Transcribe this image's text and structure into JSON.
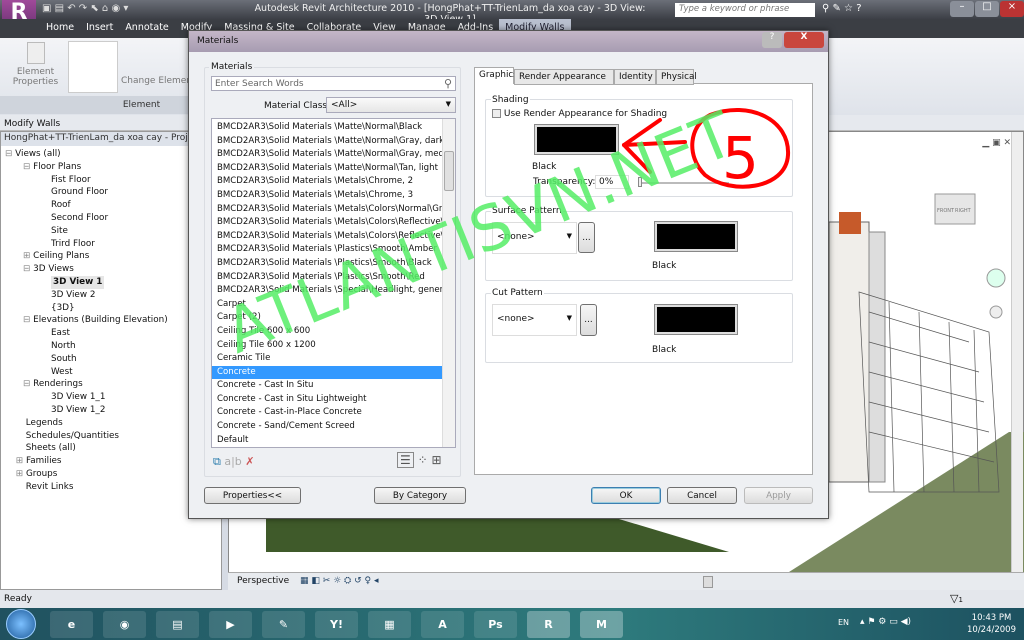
{
  "app": {
    "title": "Autodesk Revit Architecture 2010 - [HongPhat+TT-TrienLam_da xoa cay - 3D View: 3D View 1]",
    "search_placeholder": "Type a keyword or phrase"
  },
  "ribbon": {
    "tabs": [
      "Home",
      "Insert",
      "Annotate",
      "Modify",
      "Massing & Site",
      "Collaborate",
      "View",
      "Manage",
      "Add-Ins",
      "Modify Walls"
    ],
    "active_tab": "Modify Walls",
    "element_properties": "Element Properties",
    "change_element": "Change Element",
    "panel_label": "Element"
  },
  "context_bar": "Modify Walls",
  "browser": {
    "header": "HongPhat+TT-TrienLam_da xoa cay - Project Browser",
    "items": [
      {
        "label": "Views (all)",
        "level": 0,
        "toggle": "-"
      },
      {
        "label": "Floor Plans",
        "level": 1,
        "toggle": "-"
      },
      {
        "label": "Fist Floor",
        "level": 2
      },
      {
        "label": "Ground Floor",
        "level": 2
      },
      {
        "label": "Roof",
        "level": 2
      },
      {
        "label": "Second Floor",
        "level": 2
      },
      {
        "label": "Site",
        "level": 2
      },
      {
        "label": "Trird Floor",
        "level": 2
      },
      {
        "label": "Ceiling Plans",
        "level": 1,
        "toggle": "+"
      },
      {
        "label": "3D Views",
        "level": 1,
        "toggle": "-"
      },
      {
        "label": "3D View 1",
        "level": 2,
        "bold": true
      },
      {
        "label": "3D View 2",
        "level": 2
      },
      {
        "label": "{3D}",
        "level": 2
      },
      {
        "label": "Elevations (Building Elevation)",
        "level": 1,
        "toggle": "-"
      },
      {
        "label": "East",
        "level": 2
      },
      {
        "label": "North",
        "level": 2
      },
      {
        "label": "South",
        "level": 2
      },
      {
        "label": "West",
        "level": 2
      },
      {
        "label": "Renderings",
        "level": 1,
        "toggle": "-"
      },
      {
        "label": "3D View 1_1",
        "level": 2
      },
      {
        "label": "3D View 1_2",
        "level": 2
      },
      {
        "label": "Legends",
        "level": 0.6
      },
      {
        "label": "Schedules/Quantities",
        "level": 0.6
      },
      {
        "label": "Sheets (all)",
        "level": 0.6
      },
      {
        "label": "Families",
        "level": 0.6,
        "toggle": "+"
      },
      {
        "label": "Groups",
        "level": 0.6,
        "toggle": "+"
      },
      {
        "label": "Revit Links",
        "level": 0.6
      }
    ]
  },
  "viewbar": {
    "mode": "Perspective"
  },
  "viewcube": {
    "front": "FRONT",
    "right": "RIGHT"
  },
  "status": "Ready",
  "filter_count": "1",
  "dialog": {
    "title": "Materials",
    "help": "?",
    "close": "X",
    "materials_group": "Materials",
    "search_placeholder": "Enter Search Words",
    "class_label": "Material Class:",
    "class_value": "<All>",
    "list": [
      "BMCD2AR3\\Solid Materials \\Matte\\Normal\\Black",
      "BMCD2AR3\\Solid Materials \\Matte\\Normal\\Gray, dark",
      "BMCD2AR3\\Solid Materials \\Matte\\Normal\\Gray, medium",
      "BMCD2AR3\\Solid Materials \\Matte\\Normal\\Tan, light",
      "BMCD2AR3\\Solid Materials \\Metals\\Chrome, 2",
      "BMCD2AR3\\Solid Materials \\Metals\\Chrome, 3",
      "BMCD2AR3\\Solid Materials \\Metals\\Colors\\Normal\\Gray...",
      "BMCD2AR3\\Solid Materials \\Metals\\Colors\\Reflective\\G...",
      "BMCD2AR3\\Solid Materials \\Metals\\Colors\\Reflective\\G...",
      "BMCD2AR3\\Solid Materials \\Plastics\\Smooth\\Amber",
      "BMCD2AR3\\Solid Materials \\Plastics\\Smooth\\Black",
      "BMCD2AR3\\Solid Materials \\Plastics\\Smooth\\Red",
      "BMCD2AR3\\Solid Materials \\Special\\Headlight, generic, ...",
      "Carpet",
      "Carpet (2)",
      "Ceiling Tile 600 x 600",
      "Ceiling Tile 600 x 1200",
      "Ceramic Tile",
      "Concrete",
      "Concrete - Cast In Situ",
      "Concrete - Cast in Situ Lightweight",
      "Concrete - Cast-in-Place Concrete",
      "Concrete - Sand/Cement Screed",
      "Default"
    ],
    "selected": "Concrete",
    "tabs": [
      "Graphics",
      "Render Appearance",
      "Identity",
      "Physical"
    ],
    "active_tab": "Graphics",
    "shading": {
      "label": "Shading",
      "use_render": "Use Render Appearance for Shading",
      "use_render_checked": false,
      "color_name": "Black",
      "color": "#000000",
      "transparency_label": "Transparency:",
      "transparency": "0%"
    },
    "surface": {
      "label": "Surface Pattern",
      "pattern": "<none>",
      "browse": "...",
      "color_name": "Black"
    },
    "cut": {
      "label": "Cut Pattern",
      "pattern": "<none>",
      "browse": "...",
      "color_name": "Black"
    },
    "buttons": {
      "properties": "Properties<<",
      "by_category": "By Category",
      "ok": "OK",
      "cancel": "Cancel",
      "apply": "Apply"
    }
  },
  "annotation": {
    "number": "5",
    "color": "#ff0000"
  },
  "watermark": "ATLANTISVN.NET",
  "taskbar": {
    "apps": [
      "start",
      "internet-explorer",
      "firefox",
      "explorer",
      "media-player",
      "paint",
      "yahoo-messenger",
      "control-panel",
      "acrobat",
      "photoshop",
      "revit",
      "3ds-max"
    ],
    "lang": "EN",
    "time": "10:43 PM",
    "date": "10/24/2009"
  }
}
